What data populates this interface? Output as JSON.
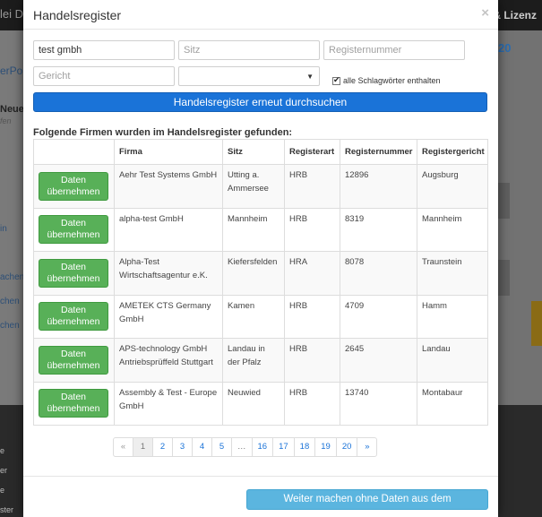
{
  "background": {
    "topbar_left": "lei Da",
    "topbar_right": "& Lizenz",
    "sidebar_portal": "erPort",
    "sidebar_title": "Neue",
    "sidebar_sub": "fen",
    "sidebar_items": [
      "in",
      "achen",
      "chen",
      "chen"
    ],
    "right_number": "20",
    "footer_items": [
      "e",
      "er",
      "e",
      "ster"
    ]
  },
  "modal": {
    "title": "Handelsregister",
    "close_label": "×",
    "search": {
      "company_value": "test gmbh",
      "sitz_placeholder": "Sitz",
      "registernummer_placeholder": "Registernummer",
      "gericht_placeholder": "Gericht",
      "select_value": "",
      "all_keywords_label": "alle Schlagwörter enthalten",
      "all_keywords_checked": true,
      "search_button_label": "Handelsregister erneut durchsuchen"
    },
    "results_heading": "Folgende Firmen wurden im Handelsregister gefunden:",
    "table": {
      "headers": [
        "",
        "Firma",
        "Sitz",
        "Registerart",
        "Registernummer",
        "Registergericht"
      ],
      "take_button_label": "Daten übernehmen",
      "rows": [
        {
          "firma": "Aehr Test Systems GmbH",
          "sitz": "Utting a. Ammersee",
          "registerart": "HRB",
          "registernummer": "12896",
          "registergericht": "Augsburg"
        },
        {
          "firma": "alpha-test GmbH",
          "sitz": "Mannheim",
          "registerart": "HRB",
          "registernummer": "8319",
          "registergericht": "Mannheim"
        },
        {
          "firma": "Alpha-Test Wirtschaftsagentur e.K.",
          "sitz": "Kiefersfelden",
          "registerart": "HRA",
          "registernummer": "8078",
          "registergericht": "Traunstein"
        },
        {
          "firma": "AMETEK CTS Germany GmbH",
          "sitz": "Kamen",
          "registerart": "HRB",
          "registernummer": "4709",
          "registergericht": "Hamm"
        },
        {
          "firma": "APS-technology GmbH Antriebsprüffeld Stuttgart",
          "sitz": "Landau in der Pfalz",
          "registerart": "HRB",
          "registernummer": "2645",
          "registergericht": "Landau"
        },
        {
          "firma": "Assembly & Test - Europe GmbH",
          "sitz": "Neuwied",
          "registerart": "HRB",
          "registernummer": "13740",
          "registergericht": "Montabaur"
        }
      ]
    },
    "pagination": {
      "prev": "«",
      "pages": [
        "1",
        "2",
        "3",
        "4",
        "5",
        "…",
        "16",
        "17",
        "18",
        "19",
        "20"
      ],
      "active_page": "1",
      "next": "»"
    },
    "footer": {
      "continue_button_label": "Weiter machen ohne Daten aus dem Handelsregister"
    }
  },
  "colors": {
    "primary": "#1a73d8",
    "success": "#58b058",
    "info": "#5bb5df"
  }
}
